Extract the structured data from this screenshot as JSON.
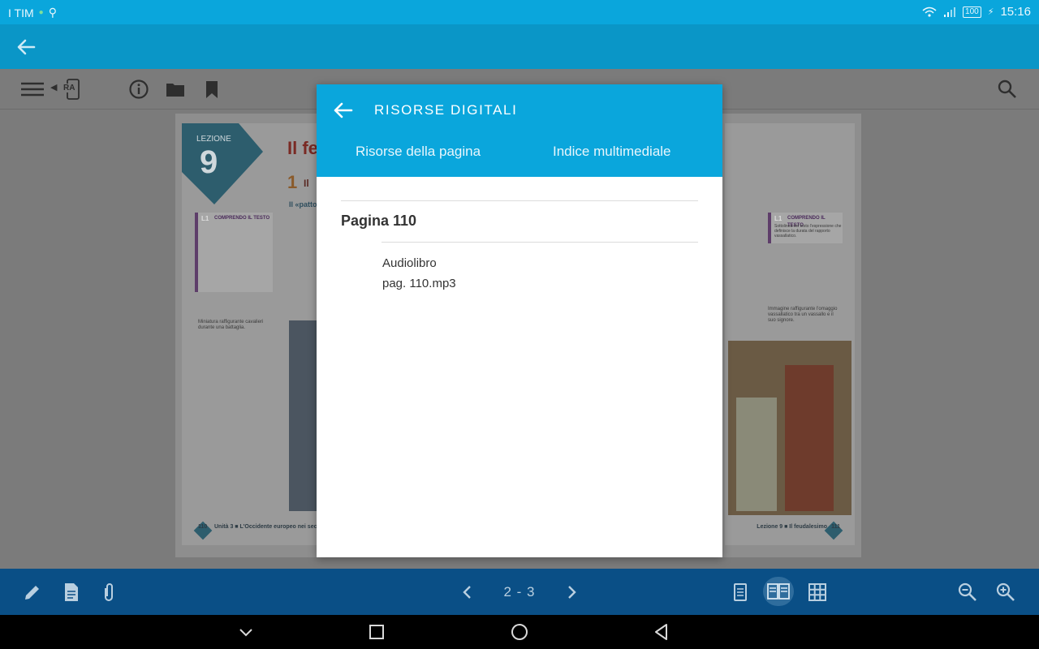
{
  "status_bar": {
    "carrier": "I TIM",
    "battery": "100",
    "time": "15:16"
  },
  "toolbar": {
    "ra_label": "RA"
  },
  "book": {
    "lesson_label": "LEZIONE",
    "lesson_number": "9",
    "title_fragment": "Il fe",
    "section_number": "1",
    "section_fragment": "Il",
    "subsection_fragment": "Il «patto",
    "box_left_title": "COMPRENDO IL TESTO",
    "box_left_code": "L1",
    "box_right_title": "COMPRENDO IL TESTO",
    "box_right_code": "L1",
    "box_right_text": "Sottolinea nel testo l'espressione che definisce la durata del rapporto vassallatico.",
    "caption_left": "Miniatura raffigurante cavalieri durante una battaglia.",
    "caption_right": "Immagine raffigurante l'omaggio vassallatico tra un vassallo e il suo signore.",
    "footer_left_page": "110",
    "footer_left_text": "Unità 3 ■ L'Occidente europeo nei secoli VIII-XI",
    "footer_right_text": "Lezione 9 ■ Il feudalesimo",
    "footer_right_page": "111"
  },
  "bottom_bar": {
    "page_range": "2 - 3"
  },
  "dialog": {
    "title": "RISORSE DIGITALI",
    "tabs": [
      "Risorse della pagina",
      "Indice multimediale"
    ],
    "page_label": "Pagina 110",
    "resource": {
      "type": "Audiolibro",
      "file": "pag. 110.mp3"
    }
  },
  "colors": {
    "status_bar": "#0aa6dc",
    "app_bar": "#0a96c7",
    "bottom_bar": "#0a4f86",
    "dialog_header": "#0aa6dc"
  }
}
